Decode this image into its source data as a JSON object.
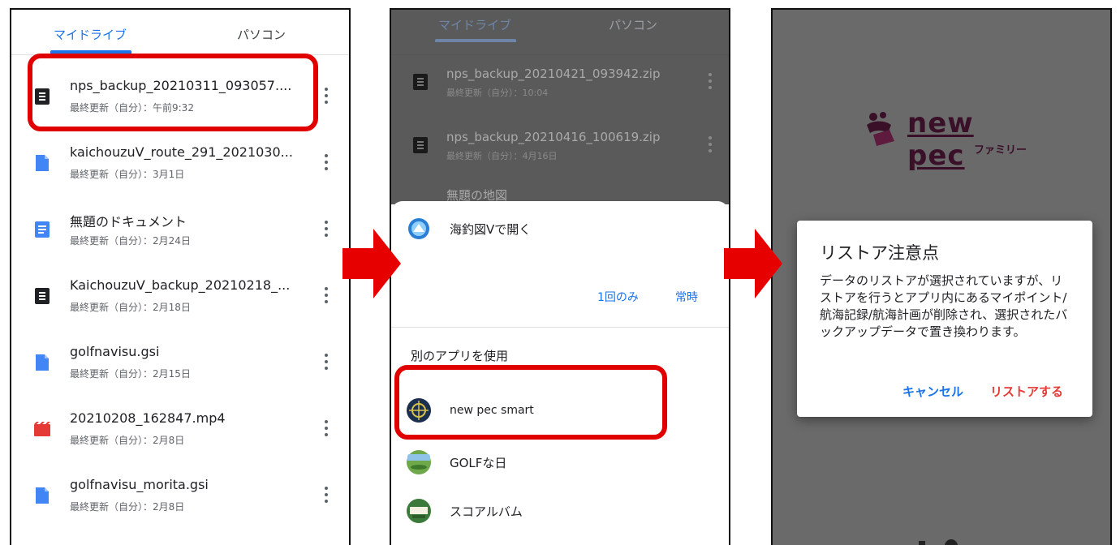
{
  "colors": {
    "accent": "#1a73e8",
    "highlight": "#e10000",
    "arrow": "#e60000",
    "restore": "#e53935"
  },
  "panel1": {
    "tabs": [
      "マイドライブ",
      "パソコン"
    ],
    "files": [
      {
        "name": "nps_backup_20210311_093057....",
        "meta": "最終更新（自分）：午前9:32",
        "icon": "archive-file-icon"
      },
      {
        "name": "kaichouzuV_route_291_2021030...",
        "meta": "最終更新（自分）：3月1日",
        "icon": "generic-file-icon"
      },
      {
        "name": "無題のドキュメント",
        "meta": "最終更新（自分）：2月24日",
        "icon": "docs-file-icon"
      },
      {
        "name": "KaichouzuV_backup_20210218_...",
        "meta": "最終更新（自分）：2月18日",
        "icon": "archive-file-icon"
      },
      {
        "name": "golfnavisu.gsi",
        "meta": "最終更新（自分）：2月15日",
        "icon": "generic-file-icon"
      },
      {
        "name": "20210208_162847.mp4",
        "meta": "最終更新（自分）：2月8日",
        "icon": "video-file-icon"
      },
      {
        "name": "golfnavisu_morita.gsi",
        "meta": "最終更新（自分）：2月8日",
        "icon": "generic-file-icon"
      }
    ]
  },
  "panel2": {
    "tabs": [
      "マイドライブ",
      "パソコン"
    ],
    "files": [
      {
        "name": "nps_backup_20210421_093942.zip",
        "meta": "最終更新（自分）：10:04"
      },
      {
        "name": "nps_backup_20210416_100619.zip",
        "meta": "最終更新（自分）：4月16日"
      },
      {
        "name": "無題の地図",
        "meta": ""
      }
    ],
    "sheet": {
      "open_with": "海釣図Vで開く",
      "once_button": "1回のみ",
      "always_button": "常時",
      "section_title": "別のアプリを使用",
      "apps": [
        "new pec smart",
        "GOLFな日",
        "スコアルバム"
      ]
    }
  },
  "panel3": {
    "logo_text": "new pec",
    "logo_sub": "ファミリー",
    "dialog": {
      "title": "リストア注意点",
      "body": "データのリストアが選択されていますが、リストアを行うとアプリ内にあるマイポイント/航海記録/航海計画が削除され、選択されたバックアップデータで置き換わります。",
      "cancel": "キャンセル",
      "confirm": "リストアする"
    }
  }
}
